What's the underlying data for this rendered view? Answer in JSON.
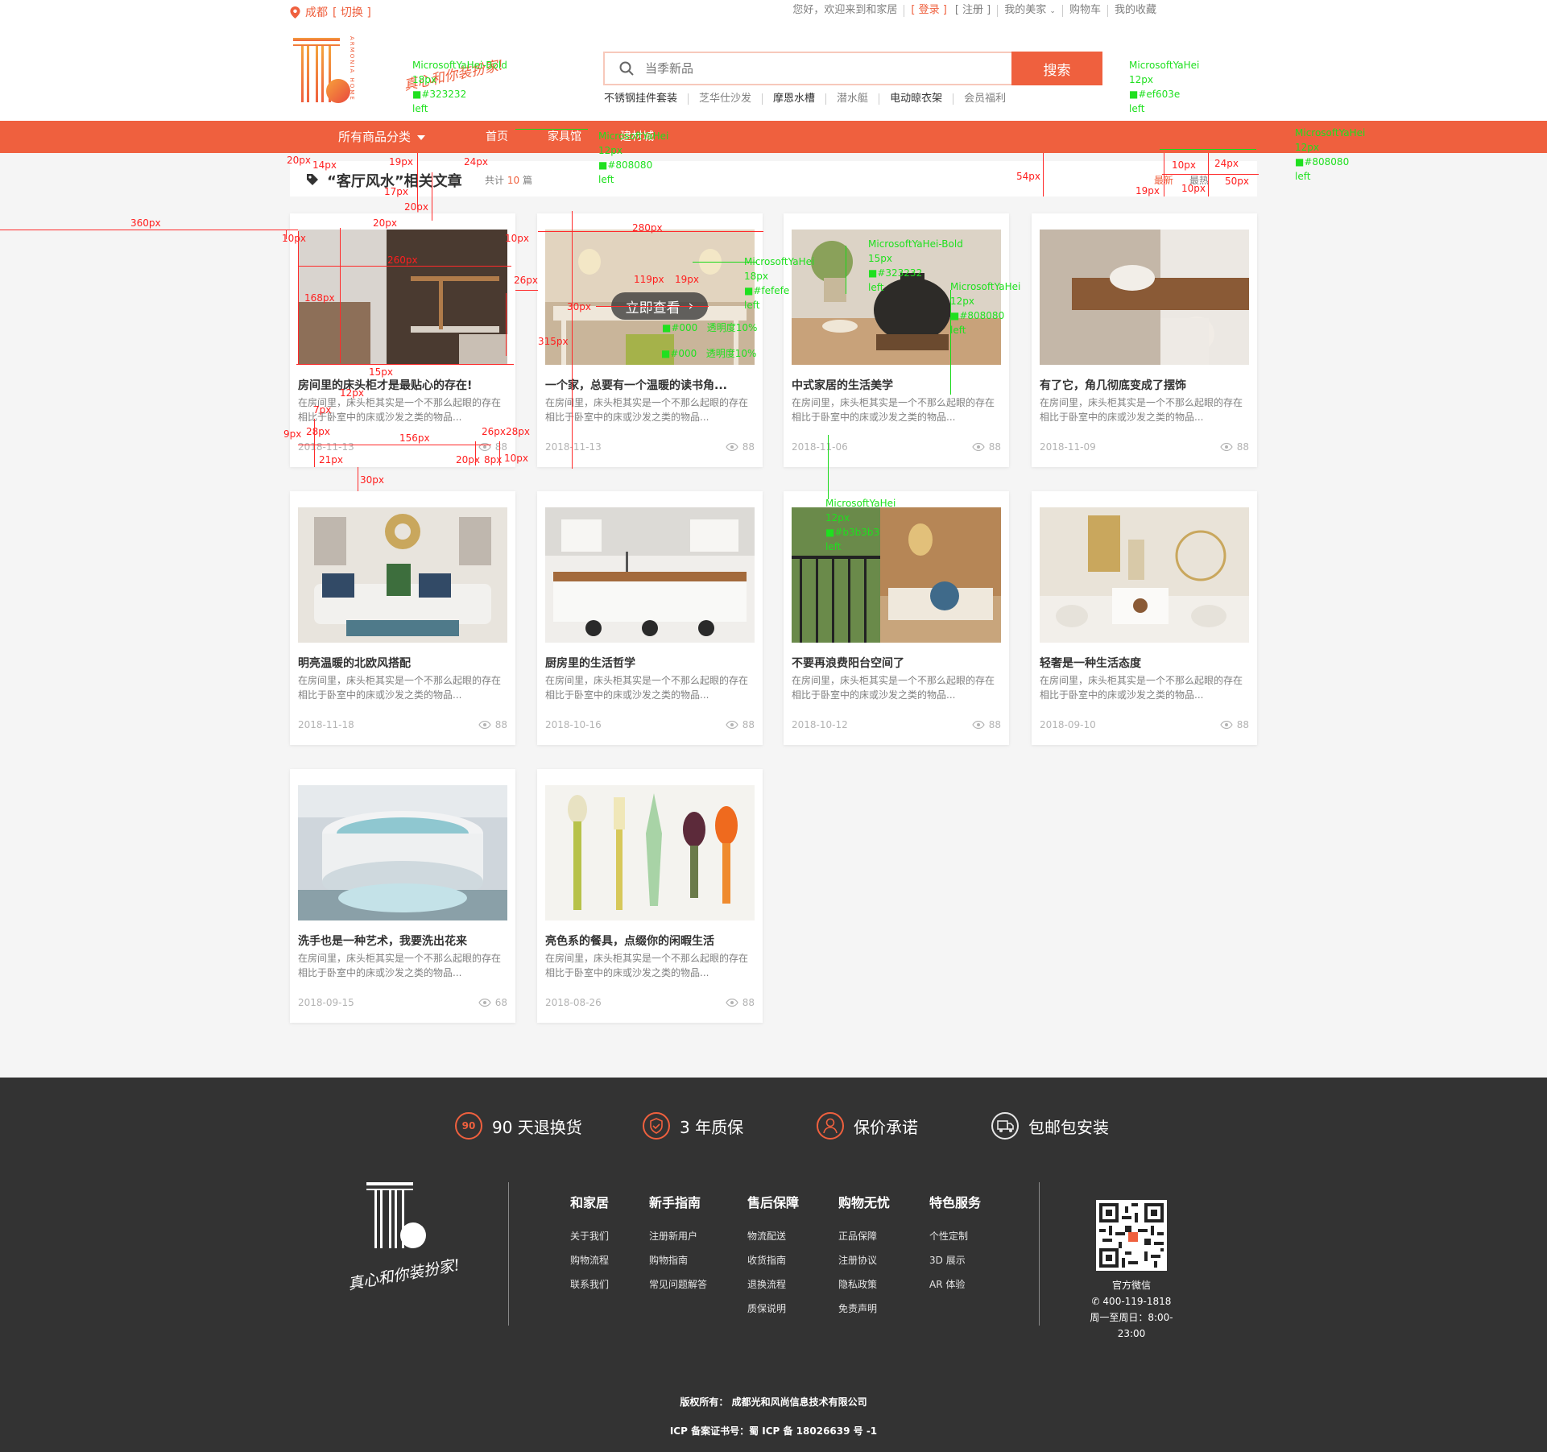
{
  "topbar": {
    "city": "成都",
    "switch_label": "[ 切换 ]",
    "welcome": "您好，欢迎来到和家居",
    "login": "[ 登录 ]",
    "register": "[ 注册 ]",
    "my_home": "我的美家",
    "cart": "购物车",
    "favorites": "我的收藏"
  },
  "header": {
    "slogan": "真心和你装扮家!",
    "brand_vertical": "ARMONIA HOME",
    "search_placeholder": "当季新品",
    "search_button": "搜索",
    "hot_words": [
      "不锈钢挂件套装",
      "芝华仕沙发",
      "摩恩水槽",
      "潜水艇",
      "电动晾衣架",
      "会员福利"
    ]
  },
  "nav": {
    "all_categories": "所有商品分类",
    "items": [
      "首页",
      "家具馆",
      "建材城"
    ]
  },
  "section": {
    "title": "“客厅风水”相关文章",
    "count_prefix": "共计",
    "count": "10",
    "count_suffix": "篇",
    "sort": [
      "最新",
      "最热"
    ]
  },
  "articles": [
    {
      "title": "房间里的床头柜才是最贴心的存在!",
      "desc": "在房间里，床头柜其实是一个不那么起眼的存在相比于卧室中的床或沙发之类的物品...",
      "date": "2018-11-13",
      "views": "88"
    },
    {
      "title": "一个家，总要有一个温暖的读书角...",
      "desc": "在房间里，床头柜其实是一个不那么起眼的存在相比于卧室中的床或沙发之类的物品...",
      "date": "2018-11-13",
      "views": "88",
      "overlay": "立即查看"
    },
    {
      "title": "中式家居的生活美学",
      "desc": "在房间里，床头柜其实是一个不那么起眼的存在相比于卧室中的床或沙发之类的物品...",
      "date": "2018-11-06",
      "views": "88"
    },
    {
      "title": "有了它，角几彻底变成了摆饰",
      "desc": "在房间里，床头柜其实是一个不那么起眼的存在相比于卧室中的床或沙发之类的物品...",
      "date": "2018-11-09",
      "views": "88"
    },
    {
      "title": "明亮温暖的北欧风搭配",
      "desc": "在房间里，床头柜其实是一个不那么起眼的存在相比于卧室中的床或沙发之类的物品...",
      "date": "2018-11-18",
      "views": "88"
    },
    {
      "title": "厨房里的生活哲学",
      "desc": "在房间里，床头柜其实是一个不那么起眼的存在相比于卧室中的床或沙发之类的物品...",
      "date": "2018-10-16",
      "views": "88"
    },
    {
      "title": "不要再浪费阳台空间了",
      "desc": "在房间里，床头柜其实是一个不那么起眼的存在相比于卧室中的床或沙发之类的物品...",
      "date": "2018-10-12",
      "views": "88"
    },
    {
      "title": "轻奢是一种生活态度",
      "desc": "在房间里，床头柜其实是一个不那么起眼的存在相比于卧室中的床或沙发之类的物品...",
      "date": "2018-09-10",
      "views": "88"
    },
    {
      "title": "洗手也是一种艺术，我要洗出花来",
      "desc": "在房间里，床头柜其实是一个不那么起眼的存在相比于卧室中的床或沙发之类的物品...",
      "date": "2018-09-15",
      "views": "68"
    },
    {
      "title": "亮色系的餐具，点缀你的闲暇生活",
      "desc": "在房间里，床头柜其实是一个不那么起眼的存在相比于卧室中的床或沙发之类的物品...",
      "date": "2018-08-26",
      "views": "88"
    }
  ],
  "footer": {
    "services": [
      {
        "icon": "90-days-icon",
        "badge": "90",
        "label": "90 天退换货"
      },
      {
        "icon": "shield-icon",
        "badge": "",
        "label": "3 年质保"
      },
      {
        "icon": "person-icon",
        "badge": "",
        "label": "保价承诺"
      },
      {
        "icon": "truck-icon",
        "badge": "",
        "label": "包邮包安装"
      }
    ],
    "slogan": "真心和你装扮家!",
    "columns": [
      {
        "title": "和家居",
        "links": [
          "关于我们",
          "购物流程",
          "联系我们"
        ]
      },
      {
        "title": "新手指南",
        "links": [
          "注册新用户",
          "购物指南",
          "常见问题解答"
        ]
      },
      {
        "title": "售后保障",
        "links": [
          "物流配送",
          "收货指南",
          "退换流程",
          "质保说明"
        ]
      },
      {
        "title": "购物无忧",
        "links": [
          "正品保障",
          "注册协议",
          "隐私政策",
          "免责声明"
        ]
      },
      {
        "title": "特色服务",
        "links": [
          "个性定制",
          "3D 展示",
          "AR 体验"
        ]
      }
    ],
    "wechat_label": "官方微信",
    "phone": "400-119-1818",
    "hours": "周一至周日：8:00-23:00",
    "copyright": "版权所有：  成都光和风尚信息技术有限公司",
    "icp": "ICP 备案证书号：蜀 ICP 备 18026639 号 -1"
  },
  "annotations": {
    "green": [
      {
        "text": "MicrosoftYaHei-Bold\n18px\n■#323232\nleft"
      },
      {
        "text": "MicrosoftYaHei\n12px\n■#ef603e\nleft"
      },
      {
        "text": "MicrosoftYaHei\n12px\n■#808080\nleft"
      },
      {
        "text": "MicrosoftYaHei\n12px\n■#808080\nleft"
      },
      {
        "text": "MicrosoftYaHei-Bold\n15px\n■#323232\nleft"
      },
      {
        "text": "MicrosoftYaHei\n12px\n■#808080\nleft"
      },
      {
        "text": "MicrosoftYaHei\n18px\n■#fefefe\nleft"
      },
      {
        "text": "MicrosoftYaHei\n12px\n■#b3b3b3\nleft"
      },
      {
        "text": "■#000   透明度10%"
      },
      {
        "text": "■#000   透明度10%"
      }
    ],
    "red": [
      "20px",
      "14px",
      "19px",
      "24px",
      "17px",
      "20px",
      "20px",
      "360px",
      "10px",
      "10px",
      "260px",
      "168px",
      "280px",
      "26px",
      "119px",
      "19px",
      "30px",
      "315px",
      "15px",
      "12px",
      "7px",
      "9px",
      "28px",
      "156px",
      "26px",
      "28px",
      "20px",
      "8px",
      "10px",
      "21px",
      "30px",
      "54px",
      "10px",
      "24px",
      "19px",
      "10px",
      "50px"
    ]
  }
}
